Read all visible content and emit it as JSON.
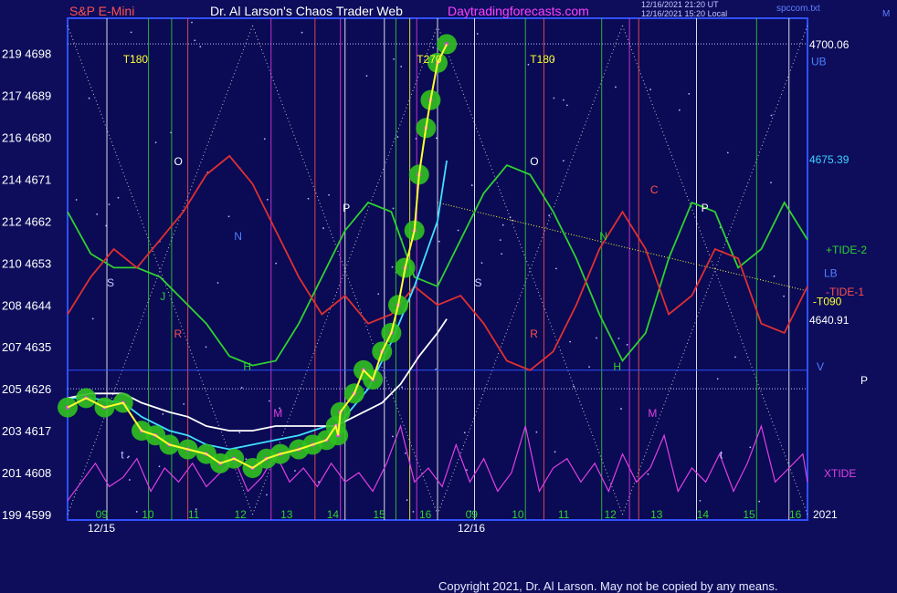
{
  "header": {
    "left": "S&P E-Mini",
    "center": "Dr. Al Larson's Chaos Trader Web",
    "site": "Daytradingforecasts.com",
    "stamp1": "12/16/2021 21:20 UT",
    "stamp2": "12/16/2021 15:20 Local",
    "file": "spccom.txt",
    "far_right": "M"
  },
  "footer": {
    "copyright": "Copyright 2021, Dr. Al Larson. May not be copied by any means."
  },
  "chart_data": {
    "type": "line",
    "title": "S&P E-Mini",
    "y_ticks": [
      {
        "idx": "199",
        "price": "4599"
      },
      {
        "idx": "201",
        "price": "4608"
      },
      {
        "idx": "203",
        "price": "4617"
      },
      {
        "idx": "205",
        "price": "4626"
      },
      {
        "idx": "207",
        "price": "4635"
      },
      {
        "idx": "208",
        "price": "4644"
      },
      {
        "idx": "210",
        "price": "4653"
      },
      {
        "idx": "212",
        "price": "4662"
      },
      {
        "idx": "214",
        "price": "4671"
      },
      {
        "idx": "216",
        "price": "4680"
      },
      {
        "idx": "217",
        "price": "4689"
      },
      {
        "idx": "219",
        "price": "4698"
      }
    ],
    "ylim": [
      4599,
      4704
    ],
    "x_hour_labels": [
      "09",
      "10",
      "11",
      "12",
      "13",
      "14",
      "15",
      "16",
      "09",
      "10",
      "11",
      "12",
      "13",
      "14",
      "15",
      "16"
    ],
    "x_date_labels": [
      "12/15",
      "12/16"
    ],
    "x_end_label": "2021",
    "right_levels": [
      {
        "label": "4700.06",
        "price": 4700.06,
        "color": "#ffffff"
      },
      {
        "label": "4675.39",
        "price": 4675.39,
        "color": "#40d0ff"
      },
      {
        "label": "4640.91",
        "price": 4640.91,
        "color": "#ffffff"
      }
    ],
    "right_labels": [
      "UB",
      "+TIDE-2",
      "LB",
      "-TIDE-1",
      "-T090",
      "V",
      "XTIDE",
      "P",
      "S"
    ],
    "markers": [
      "T180",
      "T270",
      "T180",
      "O",
      "P",
      "N",
      "S",
      "J",
      "R",
      "H",
      "M",
      "t",
      "O",
      "C",
      "N",
      "R",
      "S",
      "P",
      "H",
      "M",
      "t"
    ],
    "series": [
      {
        "name": "S&P E-Mini",
        "color": "#ffff30",
        "points": [
          [
            0,
            4622
          ],
          [
            0.4,
            4624
          ],
          [
            0.8,
            4622
          ],
          [
            1.2,
            4623
          ],
          [
            1.6,
            4617
          ],
          [
            1.9,
            4616
          ],
          [
            2.2,
            4614
          ],
          [
            2.6,
            4613
          ],
          [
            3.0,
            4612
          ],
          [
            3.3,
            4610
          ],
          [
            3.6,
            4611
          ],
          [
            4.0,
            4609
          ],
          [
            4.3,
            4611
          ],
          [
            4.6,
            4612
          ],
          [
            5.0,
            4613
          ],
          [
            5.3,
            4614
          ],
          [
            5.6,
            4615
          ],
          [
            5.8,
            4618
          ],
          [
            5.85,
            4616
          ],
          [
            5.9,
            4621
          ],
          [
            6.2,
            4625
          ],
          [
            6.4,
            4630
          ],
          [
            6.6,
            4628
          ],
          [
            6.8,
            4634
          ],
          [
            7.0,
            4638
          ],
          [
            7.15,
            4644
          ],
          [
            7.3,
            4652
          ],
          [
            7.5,
            4660
          ],
          [
            7.6,
            4672
          ],
          [
            7.75,
            4682
          ],
          [
            7.85,
            4688
          ],
          [
            8.0,
            4696
          ],
          [
            8.2,
            4700
          ]
        ]
      },
      {
        "name": "",
        "color": "#40e0ff",
        "points": [
          [
            0,
            4624
          ],
          [
            0.5,
            4624
          ],
          [
            1.2,
            4623
          ],
          [
            1.6,
            4620
          ],
          [
            2.2,
            4617
          ],
          [
            2.6,
            4616
          ],
          [
            3.0,
            4614
          ],
          [
            3.5,
            4613
          ],
          [
            4.0,
            4614
          ],
          [
            4.5,
            4615
          ],
          [
            5.0,
            4616
          ],
          [
            5.6,
            4618
          ],
          [
            5.8,
            4618
          ],
          [
            6.0,
            4620
          ],
          [
            6.5,
            4626
          ],
          [
            7.0,
            4636
          ],
          [
            7.5,
            4648
          ],
          [
            8.0,
            4662
          ],
          [
            8.2,
            4675
          ]
        ]
      },
      {
        "name": "",
        "color": "#ffffff",
        "points": [
          [
            0,
            4624
          ],
          [
            0.5,
            4625
          ],
          [
            1.2,
            4625
          ],
          [
            1.6,
            4623
          ],
          [
            2.2,
            4621
          ],
          [
            2.6,
            4620
          ],
          [
            3.0,
            4618
          ],
          [
            3.5,
            4617
          ],
          [
            4.0,
            4617
          ],
          [
            4.5,
            4618
          ],
          [
            5.0,
            4618
          ],
          [
            5.6,
            4618
          ],
          [
            5.8,
            4618
          ],
          [
            6.2,
            4620
          ],
          [
            6.8,
            4623
          ],
          [
            7.2,
            4627
          ],
          [
            7.6,
            4633
          ],
          [
            8.0,
            4638
          ],
          [
            8.2,
            4641
          ]
        ]
      },
      {
        "name": "+TIDE-2",
        "color": "#30d030",
        "points": [
          [
            0,
            4664
          ],
          [
            0.5,
            4655
          ],
          [
            1.0,
            4652
          ],
          [
            1.5,
            4652
          ],
          [
            2.0,
            4650
          ],
          [
            2.5,
            4645
          ],
          [
            3.0,
            4640
          ],
          [
            3.5,
            4633
          ],
          [
            4.0,
            4631
          ],
          [
            4.5,
            4632
          ],
          [
            5.0,
            4640
          ],
          [
            5.5,
            4650
          ],
          [
            6.0,
            4660
          ],
          [
            6.5,
            4666
          ],
          [
            7.0,
            4664
          ],
          [
            7.5,
            4650
          ],
          [
            8.0,
            4648
          ],
          [
            8.5,
            4658
          ],
          [
            9.0,
            4668
          ],
          [
            9.5,
            4674
          ],
          [
            10.0,
            4672
          ],
          [
            10.5,
            4664
          ],
          [
            11.0,
            4654
          ],
          [
            11.5,
            4642
          ],
          [
            12.0,
            4632
          ],
          [
            12.5,
            4638
          ],
          [
            13.0,
            4654
          ],
          [
            13.5,
            4666
          ],
          [
            14.0,
            4664
          ],
          [
            14.5,
            4652
          ],
          [
            15.0,
            4656
          ],
          [
            15.5,
            4666
          ],
          [
            16.0,
            4658
          ]
        ]
      },
      {
        "name": "-TIDE-1",
        "color": "#e03030",
        "points": [
          [
            0,
            4642
          ],
          [
            0.5,
            4650
          ],
          [
            1.0,
            4656
          ],
          [
            1.5,
            4652
          ],
          [
            2.0,
            4658
          ],
          [
            2.5,
            4664
          ],
          [
            3.0,
            4672
          ],
          [
            3.5,
            4676
          ],
          [
            4.0,
            4670
          ],
          [
            4.5,
            4660
          ],
          [
            5.0,
            4650
          ],
          [
            5.5,
            4642
          ],
          [
            6.0,
            4646
          ],
          [
            6.5,
            4640
          ],
          [
            7.0,
            4642
          ],
          [
            7.5,
            4648
          ],
          [
            8.0,
            4644
          ],
          [
            8.5,
            4646
          ],
          [
            9.0,
            4640
          ],
          [
            9.5,
            4632
          ],
          [
            10.0,
            4630
          ],
          [
            10.5,
            4634
          ],
          [
            11.0,
            4644
          ],
          [
            11.5,
            4656
          ],
          [
            12.0,
            4664
          ],
          [
            12.5,
            4656
          ],
          [
            13.0,
            4642
          ],
          [
            13.5,
            4646
          ],
          [
            14.0,
            4656
          ],
          [
            14.5,
            4654
          ],
          [
            15.0,
            4640
          ],
          [
            15.5,
            4638
          ],
          [
            16.0,
            4648
          ]
        ]
      },
      {
        "name": "XTIDE",
        "color": "#e040e0",
        "points": [
          [
            0,
            4602
          ],
          [
            0.3,
            4606
          ],
          [
            0.6,
            4610
          ],
          [
            0.9,
            4605
          ],
          [
            1.2,
            4607
          ],
          [
            1.5,
            4611
          ],
          [
            1.8,
            4604
          ],
          [
            2.1,
            4609
          ],
          [
            2.4,
            4606
          ],
          [
            2.7,
            4610
          ],
          [
            3.0,
            4605
          ],
          [
            3.3,
            4608
          ],
          [
            3.6,
            4611
          ],
          [
            3.9,
            4604
          ],
          [
            4.2,
            4607
          ],
          [
            4.5,
            4612
          ],
          [
            4.8,
            4606
          ],
          [
            5.1,
            4609
          ],
          [
            5.4,
            4605
          ],
          [
            5.7,
            4610
          ],
          [
            6.0,
            4606
          ],
          [
            6.3,
            4608
          ],
          [
            6.6,
            4604
          ],
          [
            6.9,
            4610
          ],
          [
            7.2,
            4618
          ],
          [
            7.5,
            4606
          ],
          [
            7.8,
            4609
          ],
          [
            8.1,
            4605
          ],
          [
            8.4,
            4614
          ],
          [
            8.7,
            4606
          ],
          [
            9.0,
            4611
          ],
          [
            9.3,
            4604
          ],
          [
            9.6,
            4608
          ],
          [
            9.9,
            4618
          ],
          [
            10.2,
            4604
          ],
          [
            10.5,
            4609
          ],
          [
            10.8,
            4611
          ],
          [
            11.1,
            4606
          ],
          [
            11.4,
            4610
          ],
          [
            11.7,
            4604
          ],
          [
            12.0,
            4612
          ],
          [
            12.3,
            4606
          ],
          [
            12.6,
            4609
          ],
          [
            12.9,
            4616
          ],
          [
            13.2,
            4604
          ],
          [
            13.5,
            4609
          ],
          [
            13.8,
            4606
          ],
          [
            14.1,
            4612
          ],
          [
            14.4,
            4604
          ],
          [
            14.7,
            4610
          ],
          [
            15.0,
            4618
          ],
          [
            15.3,
            4606
          ],
          [
            15.6,
            4609
          ],
          [
            15.9,
            4612
          ],
          [
            16.0,
            4606
          ]
        ]
      }
    ],
    "grid": false
  }
}
